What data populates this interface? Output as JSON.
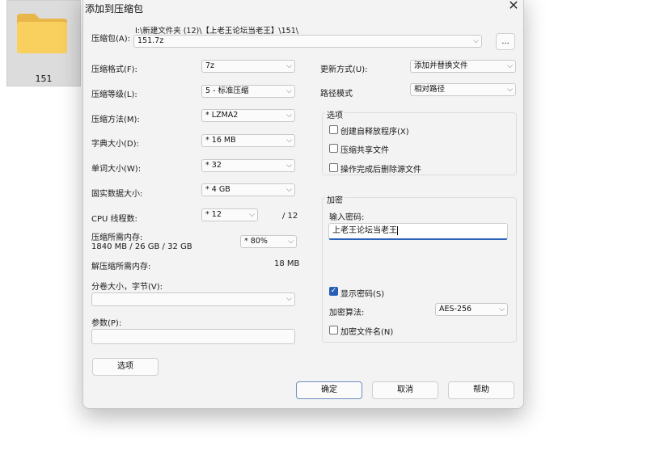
{
  "desktop": {
    "folder_label": "151"
  },
  "dialog": {
    "title": "添加到压缩包",
    "close_glyph": "✕",
    "archive": {
      "label": "压缩包(A):",
      "path": "I:\\新建文件夹 (12)\\【上老王论坛当老王】\\151\\",
      "value": "151.7z",
      "browse_label": "..."
    },
    "left": {
      "format": {
        "label": "压缩格式(F):",
        "value": "7z"
      },
      "level": {
        "label": "压缩等级(L):",
        "value": "5 - 标准压缩"
      },
      "method": {
        "label": "压缩方法(M):",
        "value": "* LZMA2"
      },
      "dict": {
        "label": "字典大小(D):",
        "value": "* 16 MB"
      },
      "word": {
        "label": "单词大小(W):",
        "value": "* 32"
      },
      "solid": {
        "label": "固实数据大小:",
        "value": "* 4 GB"
      },
      "cpu": {
        "label": "CPU 线程数:",
        "value": "* 12",
        "total": "/ 12"
      },
      "mem_comp": {
        "label": "压缩所需内存:",
        "detail": "1840 MB / 26 GB / 32 GB",
        "value": "* 80%"
      },
      "mem_decomp": {
        "label": "解压缩所需内存:",
        "value": "18 MB"
      },
      "volume": {
        "label": "分卷大小，字节(V):",
        "value": ""
      },
      "params": {
        "label": "参数(P):",
        "value": ""
      },
      "options_button": "选项"
    },
    "right": {
      "update": {
        "label": "更新方式(U):",
        "value": "添加并替换文件"
      },
      "path_mode": {
        "label": "路径模式",
        "value": "相对路径"
      },
      "options": {
        "title": "选项",
        "sfx": "创建自释放程序(X)",
        "shared": "压缩共享文件",
        "delete": "操作完成后删除源文件"
      },
      "encryption": {
        "title": "加密",
        "password_label": "输入密码:",
        "password_value": "上老王论坛当老王",
        "show_password": "显示密码(S)",
        "method_label": "加密算法:",
        "method_value": "AES-256",
        "encrypt_names": "加密文件名(N)"
      }
    },
    "buttons": {
      "ok": "确定",
      "cancel": "取消",
      "help": "帮助"
    }
  },
  "colors": {
    "accent": "#2a5fb6",
    "dialog_bg": "#f3f3f3"
  },
  "icons": {
    "folder": "folder-icon",
    "chevron": "chevron-down-icon",
    "close": "close-icon",
    "check": "checkmark-icon"
  }
}
